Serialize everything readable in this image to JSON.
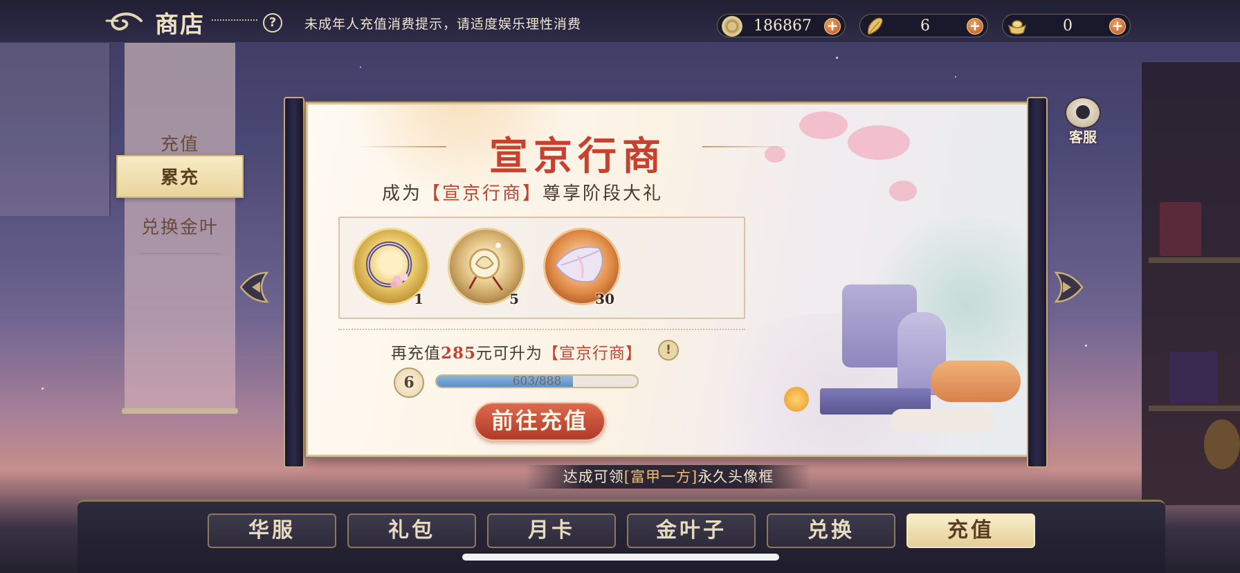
{
  "header": {
    "title": "商店",
    "help_icon": "?",
    "notice": "未成年人充值消费提示，请适度娱乐理性消费"
  },
  "currencies": [
    {
      "icon": "coin-icon",
      "value": "186867",
      "plus": "+"
    },
    {
      "icon": "gold-leaf-icon",
      "value": "6",
      "plus": "+"
    },
    {
      "icon": "ingot-icon",
      "value": "0",
      "plus": "+"
    }
  ],
  "side_menu": {
    "items": [
      {
        "label": "充值",
        "active": false
      },
      {
        "label": "累充",
        "active": true
      },
      {
        "label": "兑换金叶",
        "active": false
      }
    ]
  },
  "service": {
    "label": "客服"
  },
  "panel": {
    "title": "宣京行商",
    "subtitle_prefix": "成为",
    "subtitle_highlight": "【宣京行商】",
    "subtitle_suffix": "尊享阶段大礼",
    "rewards": [
      {
        "name": "wreath-frame-icon",
        "qty": "1"
      },
      {
        "name": "pendant-icon",
        "qty": "5"
      },
      {
        "name": "crystal-leaf-icon",
        "qty": "30"
      }
    ],
    "upgrade_prefix": "再充值",
    "upgrade_amount": "285",
    "upgrade_middle": "元可升为",
    "upgrade_highlight": "【宣京行商】",
    "info_icon": "!",
    "level": "6",
    "progress": {
      "current": 603,
      "total": 888,
      "text": "603/888"
    },
    "button_label": "前往充值"
  },
  "bottom_note": {
    "prefix": "达成可领",
    "highlight": "[富甲一方]",
    "suffix": "永久头像框"
  },
  "tabs": [
    {
      "label": "华服",
      "active": false
    },
    {
      "label": "礼包",
      "active": false
    },
    {
      "label": "月卡",
      "active": false
    },
    {
      "label": "金叶子",
      "active": false
    },
    {
      "label": "兑换",
      "active": false
    },
    {
      "label": "充值",
      "active": true
    }
  ],
  "colors": {
    "accent_red": "#c8412f",
    "gold": "#e4cf98",
    "progress_blue": "#5b90c6"
  }
}
